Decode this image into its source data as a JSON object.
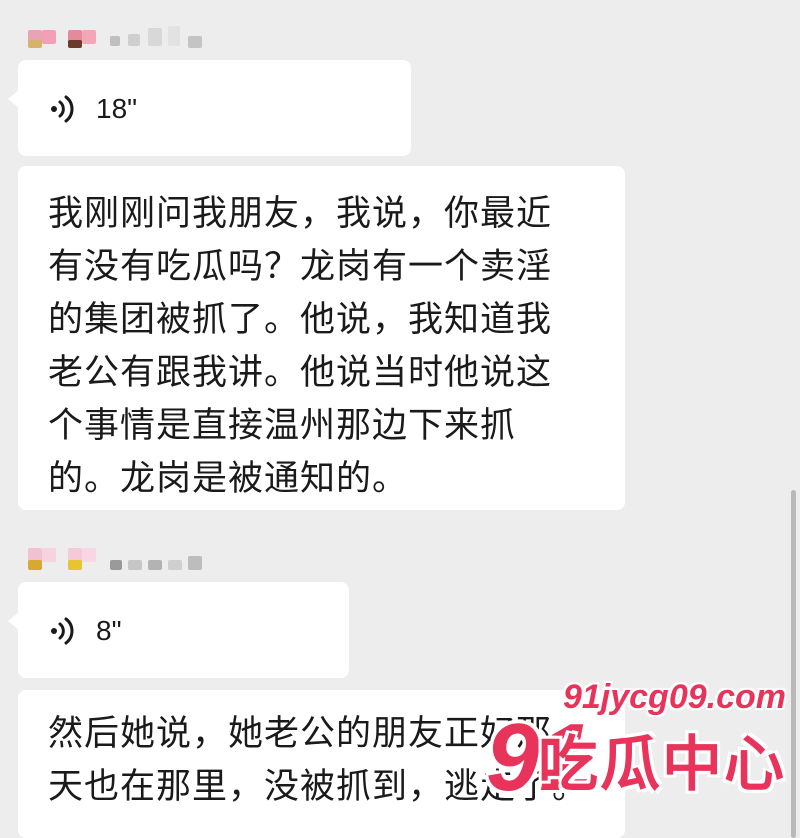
{
  "messages": [
    {
      "type": "voice",
      "duration": "18\""
    },
    {
      "type": "text",
      "text": "我刚刚问我朋友，我说，你最近\n有没有吃瓜吗？龙岗有一个卖淫\n的集团被抓了。他说，我知道我\n老公有跟我讲。他说当时他说这\n个事情是直接温州那边下来抓\n的。龙岗是被通知的。"
    },
    {
      "type": "voice",
      "duration": "8\""
    },
    {
      "type": "text",
      "text": "然后她说，她老公的朋友正好那\n天也在那里，没被抓到，逃走了。"
    }
  ],
  "watermark": {
    "url": "91jycg09.com",
    "number": "91",
    "brand": "吃瓜中心"
  },
  "colors": {
    "background": "#ededed",
    "bubble": "#ffffff",
    "watermark": "#e8345a"
  }
}
